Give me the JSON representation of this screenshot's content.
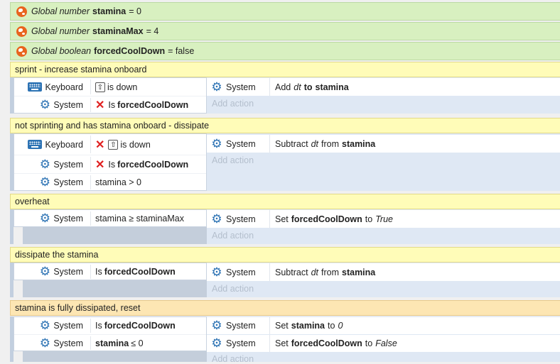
{
  "globals": [
    {
      "kind": "Global number",
      "name": "stamina",
      "value": "= 0"
    },
    {
      "kind": "Global number",
      "name": "staminaMax",
      "value": "= 4"
    },
    {
      "kind": "Global boolean",
      "name": "forcedCoolDown",
      "value": "= false"
    }
  ],
  "labels": {
    "keyboard": "Keyboard",
    "system": "System",
    "add_action": "Add action"
  },
  "ops": {
    "gte": "≥",
    "lte": "≤",
    "gt": ">"
  },
  "events": [
    {
      "title": "sprint - increase stamina onboard",
      "conditions": [
        {
          "object": "Keyboard",
          "key": "⇧",
          "text": "is down"
        },
        {
          "object": "System",
          "text": "Is",
          "bold": "forcedCoolDown"
        }
      ],
      "actions": [
        {
          "object": "System",
          "pre": "Add",
          "it": "dt",
          "mid": "to",
          "bold": "stamina"
        }
      ]
    },
    {
      "title": "not sprinting and has stamina onboard - dissipate",
      "conditions": [
        {
          "object": "Keyboard",
          "key": "⇧",
          "text": "is down"
        },
        {
          "object": "System",
          "text": "Is",
          "bold": "forcedCoolDown"
        },
        {
          "object": "System",
          "text": "stamina > 0"
        }
      ],
      "actions": [
        {
          "object": "System",
          "pre": "Subtract",
          "it": "dt",
          "mid": "from",
          "bold": "stamina"
        }
      ]
    },
    {
      "title": "overheat",
      "conditions": [
        {
          "object": "System",
          "text": "stamina ≥ staminaMax"
        }
      ],
      "actions": [
        {
          "object": "System",
          "pre": "Set",
          "bold": "forcedCoolDown",
          "mid": "to",
          "it": "True"
        }
      ]
    },
    {
      "title": "dissipate the stamina",
      "conditions": [
        {
          "object": "System",
          "text": "Is",
          "bold": "forcedCoolDown"
        }
      ],
      "actions": [
        {
          "object": "System",
          "pre": "Subtract",
          "it": "dt",
          "mid": "from",
          "bold": "stamina"
        }
      ]
    },
    {
      "title": "stamina is fully dissipated, reset",
      "conditions": [
        {
          "object": "System",
          "text": "Is",
          "bold": "forcedCoolDown"
        },
        {
          "object": "System",
          "bold": "stamina",
          "text": "≤ 0"
        }
      ],
      "actions": [
        {
          "object": "System",
          "pre": "Set",
          "bold": "stamina",
          "mid": "to",
          "it": "0"
        },
        {
          "object": "System",
          "pre": "Set",
          "bold": "forcedCoolDown",
          "mid": "to",
          "it": "False"
        }
      ]
    }
  ]
}
